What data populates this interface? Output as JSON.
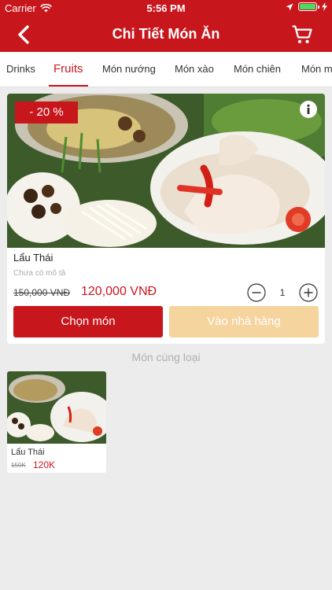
{
  "status": {
    "carrier": "Carrier",
    "time": "5:56 PM"
  },
  "nav": {
    "title": "Chi Tiết Món Ăn"
  },
  "tabs": [
    {
      "label": "Drinks",
      "active": false
    },
    {
      "label": "Fruits",
      "active": true
    },
    {
      "label": "Món nướng",
      "active": false
    },
    {
      "label": "Món xào",
      "active": false
    },
    {
      "label": "Món chiên",
      "active": false
    },
    {
      "label": "Món m",
      "active": false
    }
  ],
  "item": {
    "discount": "- 20 %",
    "name": "Lẩu Thái",
    "description": "Chưa có mô tả",
    "old_price": "150,000 VNĐ",
    "new_price": "120,000 VNĐ",
    "quantity": "1",
    "select_label": "Chọn món",
    "restaurant_label": "Vào nhà hàng"
  },
  "related": {
    "title": "Món cùng loại",
    "items": [
      {
        "name": "Lẩu Thái",
        "old_price": "150K",
        "new_price": "120K"
      }
    ]
  },
  "colors": {
    "brand": "#c8161d",
    "secondary_button": "#f5d49e",
    "background": "#ececec"
  }
}
